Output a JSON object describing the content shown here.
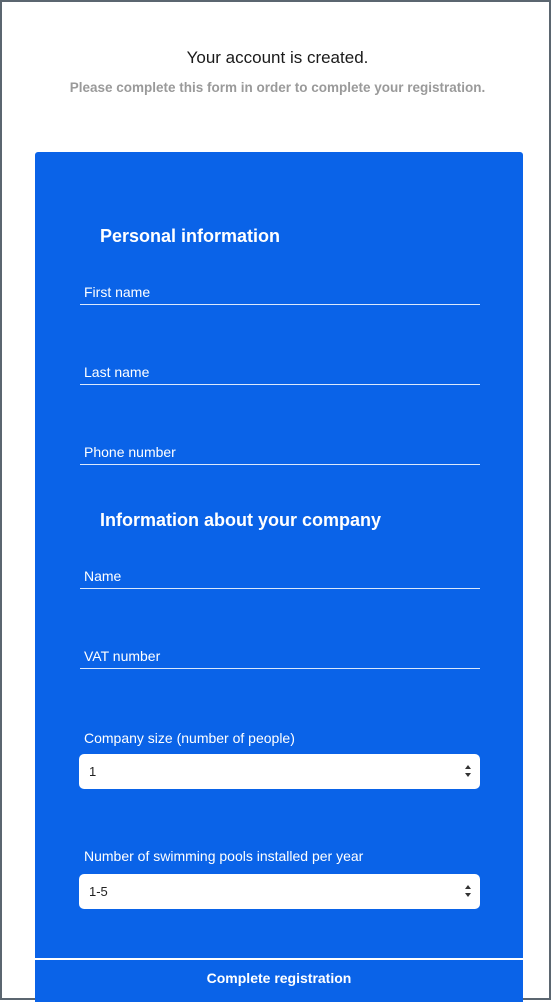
{
  "header": {
    "title": "Your account is created.",
    "subtitle": "Please complete this form in order to complete your registration."
  },
  "personal": {
    "heading": "Personal information",
    "first_name_placeholder": "First name",
    "last_name_placeholder": "Last name",
    "phone_placeholder": "Phone number"
  },
  "company": {
    "heading": "Information about your company",
    "name_placeholder": "Name",
    "vat_placeholder": "VAT number",
    "size_label": "Company size (number of people)",
    "size_value": "1",
    "pools_label": "Number of swimming pools installed per year",
    "pools_value": "1-5"
  },
  "actions": {
    "submit_label": "Complete registration"
  },
  "colors": {
    "card_background": "#0a63e8",
    "text_on_card": "#ffffff",
    "subtitle": "#9a9a9a"
  }
}
